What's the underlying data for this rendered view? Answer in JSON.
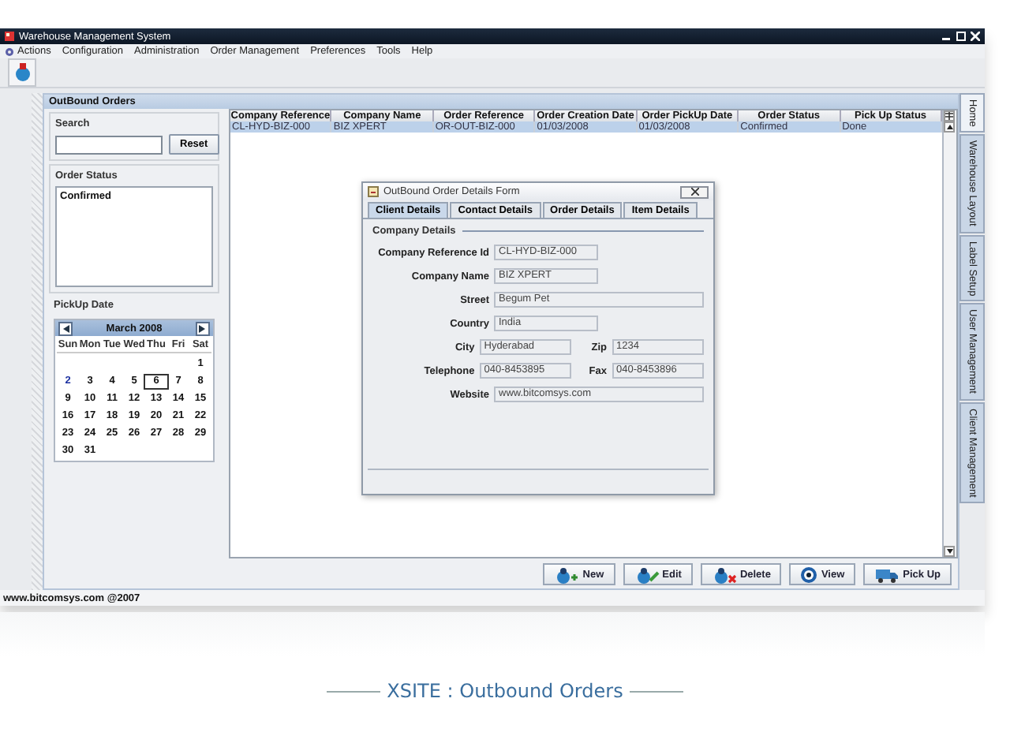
{
  "window": {
    "title": "Warehouse Management System"
  },
  "menu": [
    {
      "label": "Actions"
    },
    {
      "label": "Configuration"
    },
    {
      "label": "Administration"
    },
    {
      "label": "Order Management"
    },
    {
      "label": "Preferences"
    },
    {
      "label": "Tools"
    },
    {
      "label": "Help"
    }
  ],
  "panel": {
    "title": "OutBound Orders"
  },
  "search": {
    "title": "Search",
    "reset": "Reset"
  },
  "order_status": {
    "title": "Order Status",
    "items": [
      {
        "label": "Confirmed",
        "selected": false
      }
    ]
  },
  "pickup_date": {
    "title": "PickUp Date",
    "month": "March 2008",
    "weekdays": [
      "Sun",
      "Mon",
      "Tue",
      "Wed",
      "Thu",
      "Fri",
      "Sat"
    ],
    "weeks": [
      {
        "days": [
          {
            "label": "1",
            "selected": false,
            "today": false
          }
        ]
      },
      {
        "days": [
          {
            "label": "2",
            "selected": false,
            "today": true
          },
          {
            "label": "3",
            "selected": false,
            "today": false
          },
          {
            "label": "4",
            "selected": false,
            "today": false
          },
          {
            "label": "5",
            "selected": false,
            "today": false
          },
          {
            "label": "6",
            "selected": true,
            "today": false
          },
          {
            "label": "7",
            "selected": false,
            "today": false
          },
          {
            "label": "8",
            "selected": false,
            "today": false
          }
        ]
      },
      {
        "days": [
          {
            "label": "9",
            "selected": false,
            "today": false
          },
          {
            "label": "10",
            "selected": false,
            "today": false
          },
          {
            "label": "11",
            "selected": false,
            "today": false
          },
          {
            "label": "12",
            "selected": false,
            "today": false
          },
          {
            "label": "13",
            "selected": false,
            "today": false
          },
          {
            "label": "14",
            "selected": false,
            "today": false
          },
          {
            "label": "15",
            "selected": false,
            "today": false
          }
        ]
      },
      {
        "days": [
          {
            "label": "16",
            "selected": false,
            "today": false
          },
          {
            "label": "17",
            "selected": false,
            "today": false
          },
          {
            "label": "18",
            "selected": false,
            "today": false
          },
          {
            "label": "19",
            "selected": false,
            "today": false
          },
          {
            "label": "20",
            "selected": false,
            "today": false
          },
          {
            "label": "21",
            "selected": false,
            "today": false
          },
          {
            "label": "22",
            "selected": false,
            "today": false
          }
        ]
      },
      {
        "days": [
          {
            "label": "23",
            "selected": false,
            "today": false
          },
          {
            "label": "24",
            "selected": false,
            "today": false
          },
          {
            "label": "25",
            "selected": false,
            "today": false
          },
          {
            "label": "26",
            "selected": false,
            "today": false
          },
          {
            "label": "27",
            "selected": false,
            "today": false
          },
          {
            "label": "28",
            "selected": false,
            "today": false
          },
          {
            "label": "29",
            "selected": false,
            "today": false
          }
        ]
      },
      {
        "days": [
          {
            "label": "30",
            "selected": false,
            "today": false
          },
          {
            "label": "31",
            "selected": false,
            "today": false
          }
        ]
      }
    ]
  },
  "table": {
    "columns": [
      "Company Reference",
      "Company Name",
      "Order Reference",
      "Order Creation Date",
      "Order PickUp Date",
      "Order Status",
      "Pick Up Status"
    ],
    "rows": [
      {
        "selected": true,
        "cells": [
          "CL-HYD-BIZ-000",
          "BIZ XPERT",
          "OR-OUT-BIZ-000",
          "01/03/2008",
          "01/03/2008",
          "Confirmed",
          "Done"
        ]
      }
    ]
  },
  "dialog": {
    "title": "OutBound Order Details Form",
    "tabs": [
      {
        "label": "Client Details",
        "selected": true
      },
      {
        "label": "Contact Details",
        "selected": false
      },
      {
        "label": "Order Details",
        "selected": false
      },
      {
        "label": "Item Details",
        "selected": false
      }
    ],
    "section": "Company Details",
    "rows": [
      {
        "fields": [
          {
            "label": "Company Reference Id",
            "value": "CL-HYD-BIZ-000",
            "kind": "short"
          }
        ]
      },
      {
        "fields": [
          {
            "label": "Company Name",
            "value": "BIZ XPERT",
            "kind": "short"
          }
        ]
      },
      {
        "fields": [
          {
            "label": "Street",
            "value": "Begum Pet",
            "kind": "long"
          }
        ]
      },
      {
        "fields": [
          {
            "label": "Country",
            "value": "India",
            "kind": "short"
          }
        ]
      },
      {
        "fields": [
          {
            "label": "City",
            "value": "Hyderabad",
            "kind": "short"
          },
          {
            "label": "Zip",
            "value": "1234",
            "kind": "short"
          }
        ]
      },
      {
        "fields": [
          {
            "label": "Telephone",
            "value": "040-8453895",
            "kind": "short"
          },
          {
            "label": "Fax",
            "value": "040-8453896",
            "kind": "short"
          }
        ]
      },
      {
        "fields": [
          {
            "label": "Website",
            "value": "www.bitcomsys.com",
            "kind": "long"
          }
        ]
      }
    ]
  },
  "buttons": [
    {
      "label": "New",
      "kind": "new"
    },
    {
      "label": "Edit",
      "kind": "edit"
    },
    {
      "label": "Delete",
      "kind": "delete"
    },
    {
      "label": "View",
      "kind": "view"
    },
    {
      "label": "Pick Up",
      "kind": "pickup"
    }
  ],
  "side_tabs": [
    {
      "label": "Home",
      "selected": true
    },
    {
      "label": "Warehouse Layout",
      "selected": false
    },
    {
      "label": "Label Setup",
      "selected": false
    },
    {
      "label": "User Management",
      "selected": false
    },
    {
      "label": "Client Management",
      "selected": false
    }
  ],
  "status_bar": {
    "text": "www.bitcomsys.com @2007"
  },
  "caption": "XSITE : Outbound Orders"
}
